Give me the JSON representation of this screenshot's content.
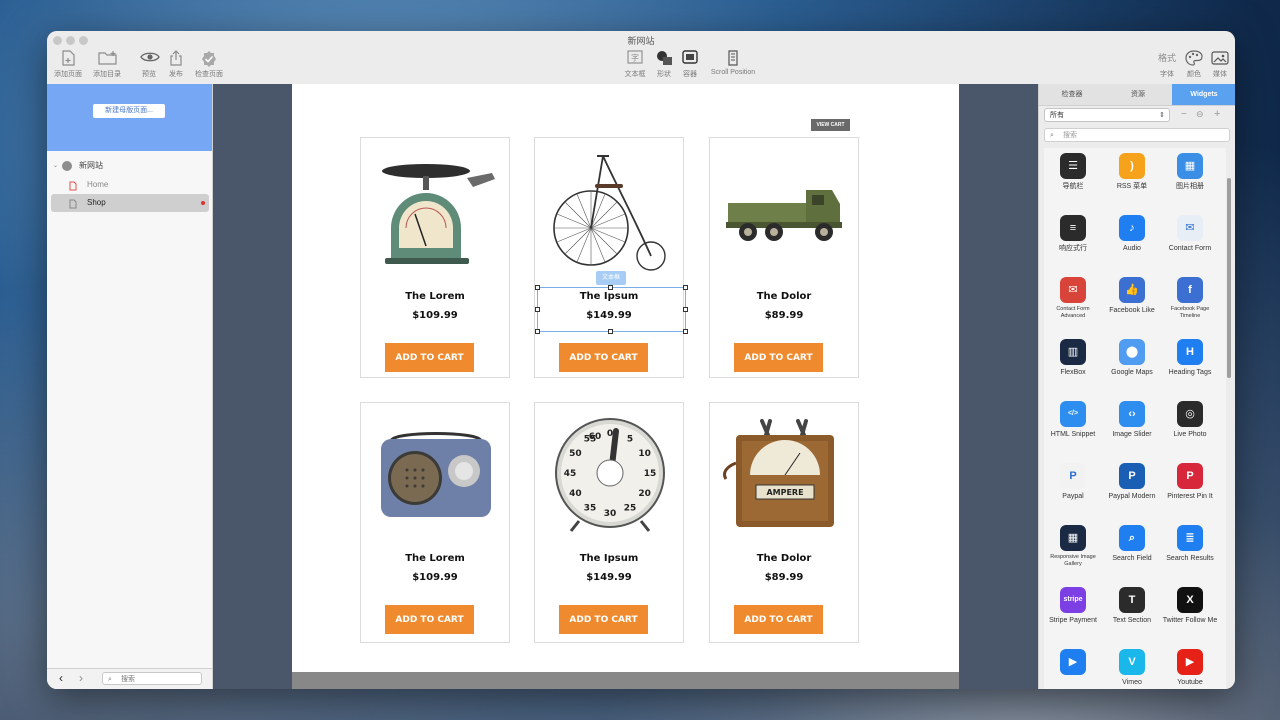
{
  "window": {
    "title": "新网站"
  },
  "toolbar": {
    "left": [
      {
        "label": "添加页面",
        "icon": "add-page-icon"
      },
      {
        "label": "添加目录",
        "icon": "add-folder-icon"
      },
      {
        "label": "预览",
        "icon": "eye-icon"
      },
      {
        "label": "发布",
        "icon": "share-icon"
      },
      {
        "label": "检查页面",
        "icon": "check-badge-icon"
      }
    ],
    "center": [
      {
        "label": "文本框",
        "icon": "textbox-icon"
      },
      {
        "label": "形状",
        "icon": "shape-icon"
      },
      {
        "label": "容器",
        "icon": "container-icon"
      },
      {
        "label": "Scroll Position",
        "icon": "scroll-icon"
      }
    ],
    "right": [
      {
        "label": "字体",
        "icon_text": "格式"
      },
      {
        "label": "颜色",
        "icon": "palette-icon"
      },
      {
        "label": "媒体",
        "icon": "media-icon"
      }
    ]
  },
  "sidebar": {
    "new_master_button": "新建母版页面...",
    "site_name": "新网站",
    "pages": [
      "Home",
      "Shop"
    ],
    "search_placeholder": "搜索"
  },
  "page": {
    "view_cart": "VIEW CART",
    "textbox_tag": "文本框",
    "products": [
      {
        "name": "The Lorem",
        "price": "$109.99",
        "cart": "ADD TO CART",
        "image": "vintage-scale-image"
      },
      {
        "name": "The Ipsum",
        "price": "$149.99",
        "cart": "ADD TO CART",
        "image": "penny-farthing-bicycle-image"
      },
      {
        "name": "The Dolor",
        "price": "$89.99",
        "cart": "ADD TO CART",
        "image": "toy-truck-image"
      },
      {
        "name": "The Lorem",
        "price": "$109.99",
        "cart": "ADD TO CART",
        "image": "retro-radio-image"
      },
      {
        "name": "The Ipsum",
        "price": "$149.99",
        "cart": "ADD TO CART",
        "image": "kitchen-timer-image"
      },
      {
        "name": "The Dolor",
        "price": "$89.99",
        "cart": "ADD TO CART",
        "image": "ampere-meter-image"
      }
    ],
    "timer_numbers": [
      "0",
      "5",
      "10",
      "15",
      "20",
      "25",
      "30",
      "35",
      "40",
      "45",
      "50",
      "55",
      "60"
    ],
    "meter_label": "AMPERE"
  },
  "right_panel": {
    "tabs": [
      "检查器",
      "资源",
      "Widgets"
    ],
    "filter": "所有",
    "search_placeholder": "搜索",
    "widgets": [
      {
        "label": "导航栏",
        "color": "#2b2b2b",
        "glyph": "☰"
      },
      {
        "label": "RSS 菜单",
        "color": "#f7a21b",
        "glyph": ")"
      },
      {
        "label": "图片相册",
        "color": "#3a8ee6",
        "glyph": "▦"
      },
      {
        "label": "响应式行",
        "color": "#2b2b2b",
        "glyph": "≡"
      },
      {
        "label": "Audio",
        "color": "#1f7ef0",
        "glyph": "♪"
      },
      {
        "label": "Contact Form",
        "color": "#e8eef5",
        "glyph": "✉"
      },
      {
        "label": "Contact Form Advanced",
        "color": "#d9443a",
        "glyph": "✉"
      },
      {
        "label": "Facebook Like",
        "color": "#3b6fd1",
        "glyph": "👍"
      },
      {
        "label": "Facebook Page Timeline",
        "color": "#3b6fd1",
        "glyph": "f"
      },
      {
        "label": "FlexBox",
        "color": "#1b2a44",
        "glyph": "▥"
      },
      {
        "label": "Google Maps",
        "color": "#4f9cf0",
        "glyph": "⬤"
      },
      {
        "label": "Heading Tags",
        "color": "#1f7ef0",
        "glyph": "H"
      },
      {
        "label": "HTML Snippet",
        "color": "#2d8ef0",
        "glyph": "</>"
      },
      {
        "label": "Image Slider",
        "color": "#2d8ef0",
        "glyph": "‹›"
      },
      {
        "label": "Live Photo",
        "color": "#2b2b2b",
        "glyph": "◎"
      },
      {
        "label": "Paypal",
        "color": "#f2f2f2",
        "glyph": "P"
      },
      {
        "label": "Paypal Modern",
        "color": "#1a5fb4",
        "glyph": "P"
      },
      {
        "label": "Pinterest Pin It",
        "color": "#d6283a",
        "glyph": "P"
      },
      {
        "label": "Responsive Image Gallery",
        "color": "#1b2a44",
        "glyph": "▦"
      },
      {
        "label": "Search Field",
        "color": "#1f7ef0",
        "glyph": "⌕"
      },
      {
        "label": "Search Results",
        "color": "#1f7ef0",
        "glyph": "≣"
      },
      {
        "label": "Stripe Payment",
        "color": "#7b3fe4",
        "glyph": "stripe"
      },
      {
        "label": "Text Section",
        "color": "#2b2b2b",
        "glyph": "T"
      },
      {
        "label": "Twitter Follow Me",
        "color": "#111111",
        "glyph": "X"
      },
      {
        "label": "",
        "color": "#1f7ef0",
        "glyph": "▶"
      },
      {
        "label": "Vimeo",
        "color": "#1ab7ea",
        "glyph": "V"
      },
      {
        "label": "Youtube",
        "color": "#e62117",
        "glyph": "▶"
      }
    ]
  }
}
